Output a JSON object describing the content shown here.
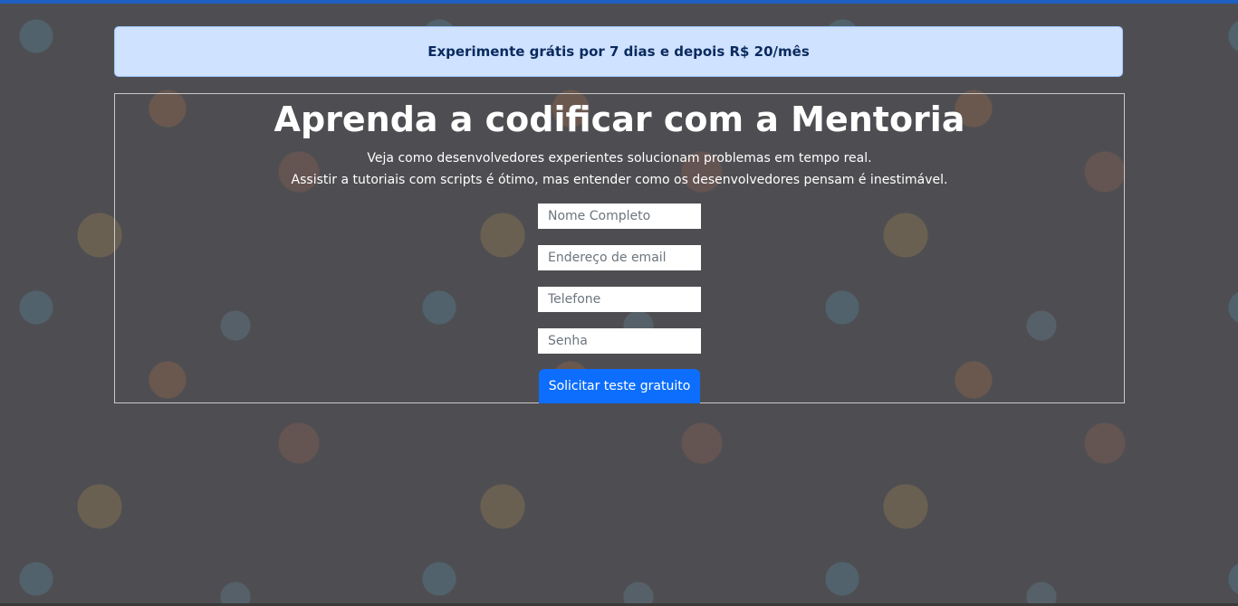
{
  "banner": {
    "text": "Experimente grátis por 7 dias e depois R$ 20/mês"
  },
  "signup": {
    "title": "Aprenda a codificar com a Mentoria",
    "subtitle_line1": "Veja como desenvolvedores experientes solucionam problemas em tempo real.",
    "subtitle_line2": "Assistir a tutoriais com scripts é ótimo, mas entender como os desenvolvedores pensam é inestimável.",
    "fields": {
      "full_name_placeholder": "Nome Completo",
      "email_placeholder": "Endereço de email",
      "phone_placeholder": "Telefone",
      "password_placeholder": "Senha"
    },
    "submit_label": "Solicitar teste gratuito"
  },
  "colors": {
    "banner_background": "#cfe2ff",
    "banner_text": "#0a2a5e",
    "primary_button": "#0d6efd",
    "page_overlay": "#4e4e52"
  }
}
